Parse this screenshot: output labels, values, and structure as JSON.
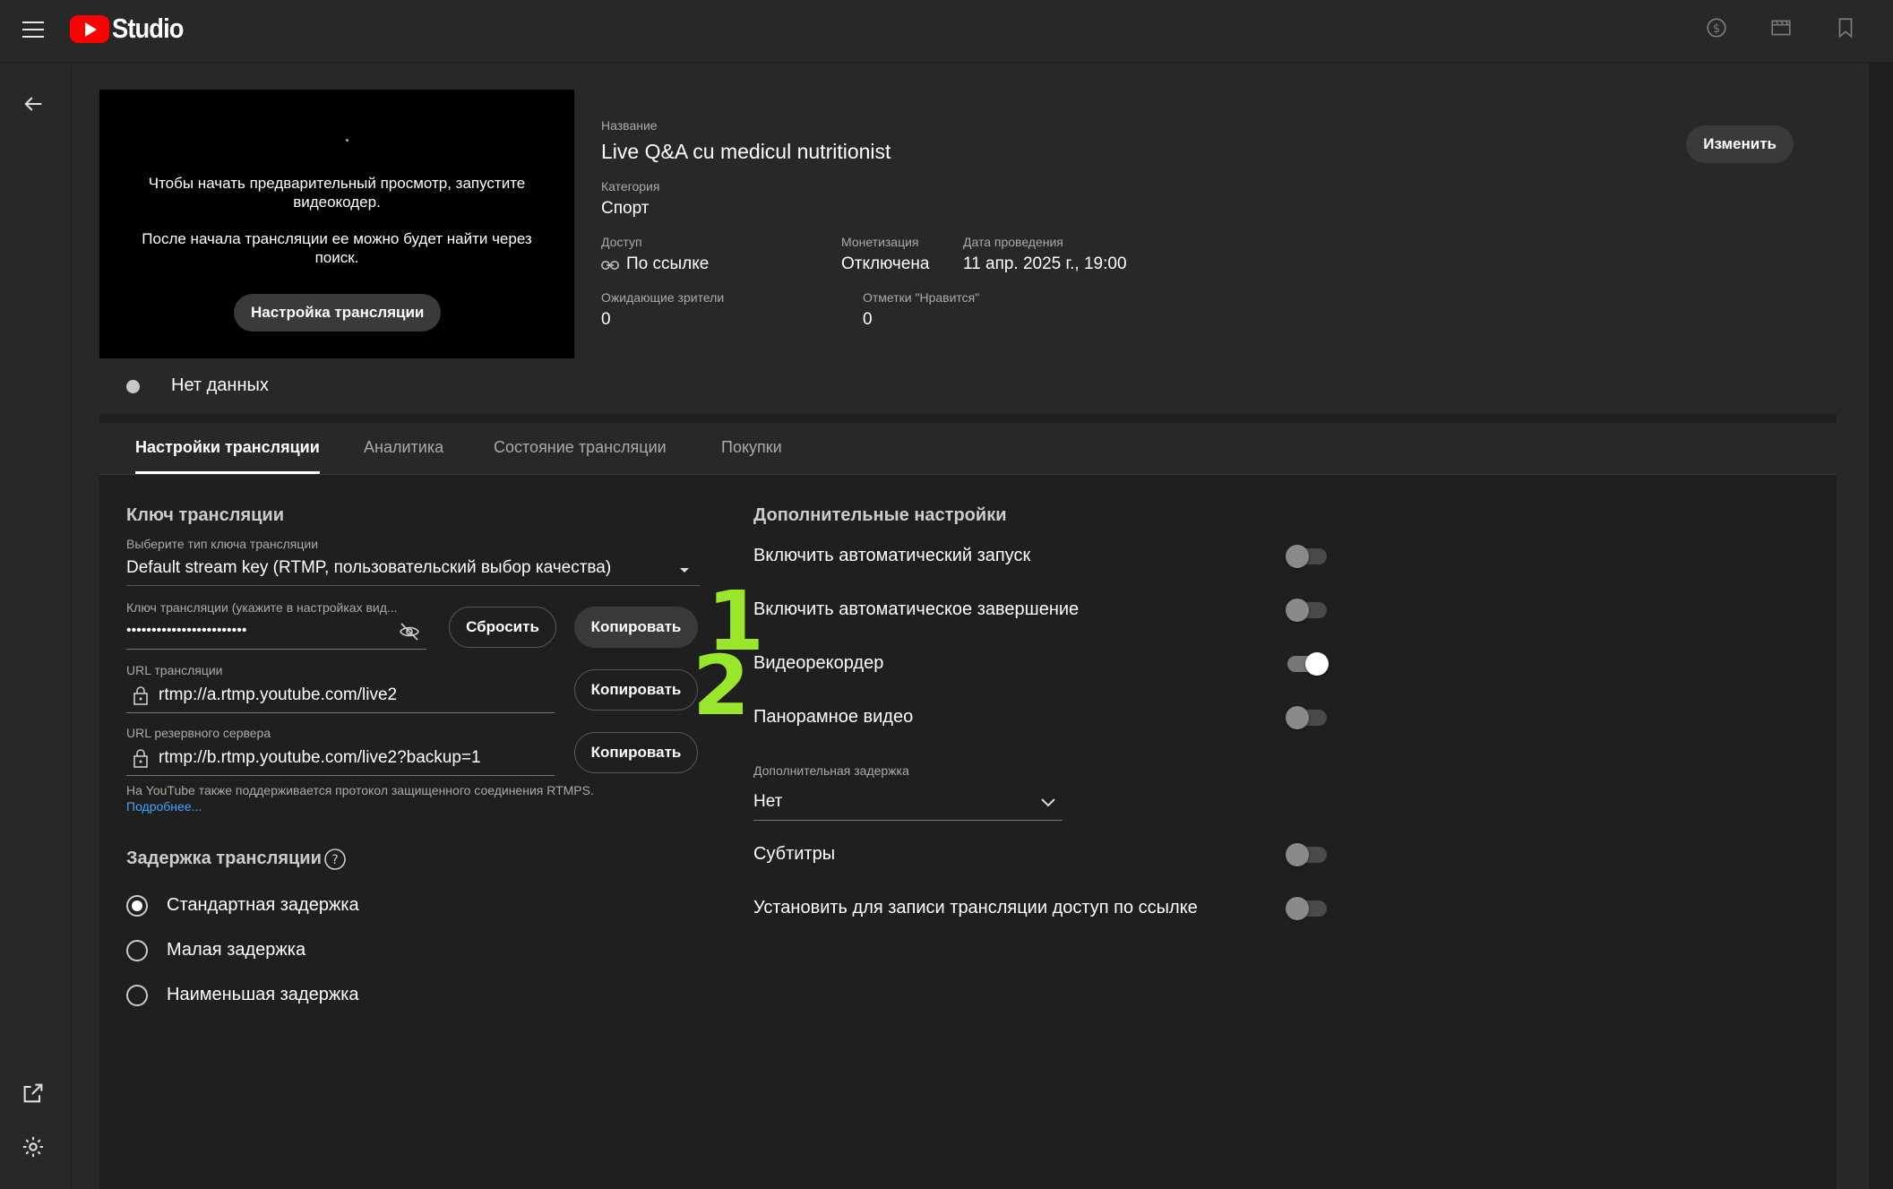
{
  "app": {
    "logo_text": "Studio",
    "brand_color": "#ff0000"
  },
  "topbar_icons": [
    "monetization-icon",
    "clapperboard-icon",
    "bookmark-icon"
  ],
  "leftnav_icons": [
    "back-arrow-icon",
    "external-link-icon",
    "settings-icon"
  ],
  "preview": {
    "message1": "Чтобы начать предварительный просмотр, запустите видеокодер.",
    "message2": "После начала трансляции ее можно будет найти через поиск.",
    "setup_button": "Настройка трансляции"
  },
  "details": {
    "title_label": "Название",
    "title": "Live Q&A cu medicul nutritionist",
    "category_label": "Категория",
    "category": "Спорт",
    "access_label": "Доступ",
    "access": "По ссылке",
    "monetization_label": "Монетизация",
    "monetization": "Отключена",
    "date_label": "Дата проведения",
    "date": "11 апр. 2025 г., 19:00",
    "waiting_label": "Ожидающие зрители",
    "waiting": "0",
    "likes_label": "Отметки \"Нравится\"",
    "likes": "0",
    "edit_button": "Изменить"
  },
  "status": {
    "text": "Нет данных"
  },
  "tabs": [
    {
      "label": "Настройки трансляции",
      "active": true
    },
    {
      "label": "Аналитика",
      "active": false
    },
    {
      "label": "Состояние трансляции",
      "active": false
    },
    {
      "label": "Покупки",
      "active": false
    }
  ],
  "stream_key": {
    "section_title": "Ключ трансляции",
    "type_label": "Выберите тип ключа трансляции",
    "type_value": "Default stream key (RTMP, пользовательский выбор качества)",
    "key_label": "Ключ трансляции (укажите в настройках вид...",
    "key_value": "••••••••••••••••••••••••",
    "reset_button": "Сбросить",
    "copy_button": "Копировать",
    "url_label": "URL трансляции",
    "url_value": "rtmp://a.rtmp.youtube.com/live2",
    "backup_label": "URL резервного сервера",
    "backup_value": "rtmp://b.rtmp.youtube.com/live2?backup=1",
    "note": "На YouTube также поддерживается протокол защищенного соединения RTMPS.",
    "more_link": "Подробнее..."
  },
  "latency": {
    "section_title": "Задержка трансляции",
    "options": [
      {
        "label": "Стандартная задержка",
        "selected": true
      },
      {
        "label": "Малая задержка",
        "selected": false
      },
      {
        "label": "Наименьшая задержка",
        "selected": false
      }
    ]
  },
  "additional": {
    "section_title": "Дополнительные настройки",
    "toggles_top": [
      {
        "label": "Включить автоматический запуск",
        "on": false
      },
      {
        "label": "Включить автоматическое завершение",
        "on": false
      },
      {
        "label": "Видеорекордер",
        "on": true
      },
      {
        "label": "Панорамное видео",
        "on": false
      }
    ],
    "delay_label": "Дополнительная задержка",
    "delay_value": "Нет",
    "toggles_bottom": [
      {
        "label": "Субтитры",
        "on": false
      },
      {
        "label": "Установить для записи трансляции доступ по ссылке",
        "on": false
      }
    ]
  },
  "annotations": {
    "one": "1",
    "two": "2",
    "color": "#9ae62c"
  }
}
